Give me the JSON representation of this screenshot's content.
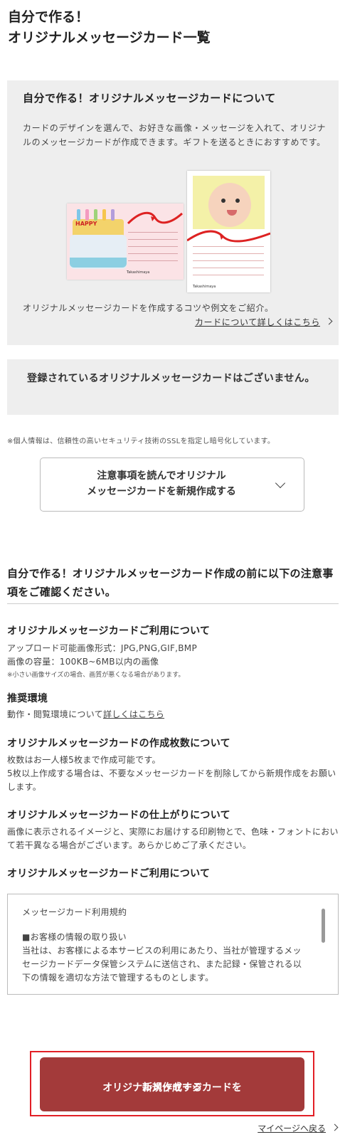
{
  "page": {
    "title_line1": "自分で作る！",
    "title_line2": "オリジナルメッセージカード一覧"
  },
  "about": {
    "heading": "自分で作る！オリジナルメッセージカードについて",
    "description": "カードのデザインを選んで、お好きな画像・メッセージを入れて、オリジナルのメッセージカードが作成できます。ギフトを送るときにおすすめです。",
    "tip": "オリジナルメッセージカードを作成するコツや例文をご紹介。",
    "detail_link": "カードについて詳しくはこちら",
    "sample_card_1": {
      "cake_text": "HAPPY",
      "brand": "Takashimaya"
    },
    "sample_card_2": {
      "brand": "Takashimaya"
    }
  },
  "empty_state": {
    "message": "登録されているオリジナルメッセージカードはございません。"
  },
  "ssl_note": "※個人情報は、信頼性の高いセキュリティ技術のSSLを指定し暗号化しています。",
  "create_toggle": {
    "line1": "注意事項を読んでオリジナル",
    "line2": "メッセージカードを新規作成する"
  },
  "notice": {
    "title": "自分で作る！オリジナルメッセージカード作成の前に以下の注意事項をご確認ください。",
    "usage": {
      "heading": "オリジナルメッセージカードご利用について",
      "formats": "アップロード可能画像形式：JPG,PNG,GIF,BMP",
      "size": "画像の容量：100KB~6MB以内の画像",
      "size_note": "※小さい画像サイズの場合、画質が悪くなる場合があります。"
    },
    "environment": {
      "heading": "推奨環境",
      "text": "動作・閲覧環境について",
      "link": "詳しくはこちら"
    },
    "count": {
      "heading": "オリジナルメッセージカードの作成枚数について",
      "line1": "枚数はお一人様5枚まで作成可能です。",
      "line2": "5枚以上作成する場合は、不要なメッセージカードを削除してから新規作成をお願いします。"
    },
    "finish": {
      "heading": "オリジナルメッセージカードの仕上がりについて",
      "text": "画像に表示されるイメージと、実際にお届けする印刷物とで、色味・フォントにおいて若干異なる場合がございます。あらかじめご了承ください。"
    },
    "usage2": {
      "heading": "オリジナルメッセージカードご利用について"
    }
  },
  "terms": {
    "title": "メッセージカード利用規約",
    "section_heading": "■お客様の情報の取り扱い",
    "body": "当社は、お客様による本サービスの利用にあたり、当社が管理するメッセージカードデータ保管システムに送信され、また記録・保管される以下の情報を適切な方法で管理するものとします。"
  },
  "cta": {
    "line1": "オリジナルメッセージカードを",
    "line2": "新規作成する"
  },
  "mypage_link": "マイページへ戻る",
  "colors": {
    "cta_bg": "#a33a3a",
    "highlight_frame": "#e21f26",
    "panel_bg": "#eeeeee"
  }
}
